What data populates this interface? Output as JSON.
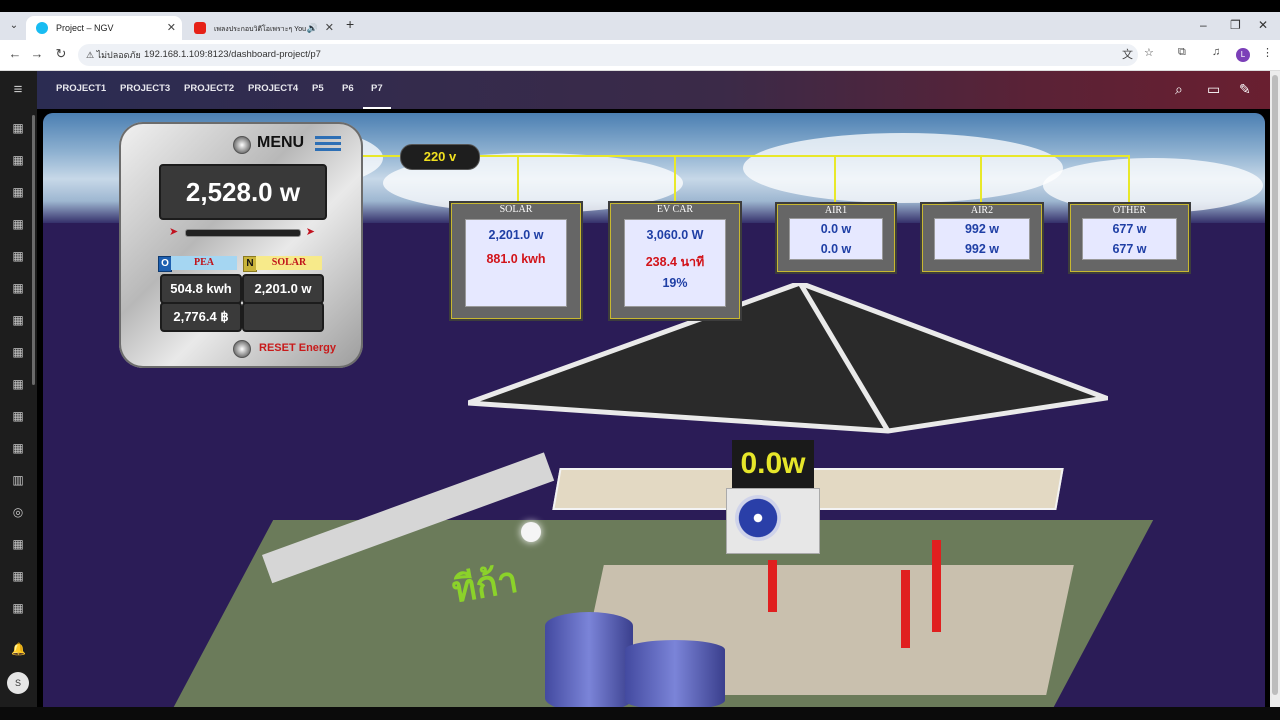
{
  "browser": {
    "tabs": [
      {
        "title": "Project – NGV",
        "active": true
      },
      {
        "title": "เพลงประกอบวิดีโอเพราะๆ You",
        "active": false,
        "audio": true
      }
    ],
    "new_tab": "+",
    "window_controls": {
      "minimize": "–",
      "restore": "❐",
      "close": "✕"
    },
    "address": {
      "security_label": "ไม่ปลอดภัย",
      "url": "192.168.1.109:8123/dashboard-project/p7"
    },
    "nav": {
      "back": "←",
      "forward": "→",
      "reload": "↻"
    },
    "profile_initial": "L"
  },
  "ha": {
    "tabs": [
      "PROJECT1",
      "PROJECT3",
      "PROJECT2",
      "PROJECT4",
      "P5",
      "P6",
      "P7"
    ],
    "active_tab": "P7",
    "user_initial": "S"
  },
  "menu_panel": {
    "title": "MENU",
    "total_power": "2,528.0 w",
    "pea_tag": "O",
    "pea_label": "PEA",
    "solar_tag": "N",
    "solar_label": "SOLAR",
    "pea_energy": "504.8 kwh",
    "solar_power": "2,201.0 w",
    "cost": "2,776.4 ฿",
    "empty_value": "",
    "reset_label": "RESET Energy"
  },
  "bus": {
    "voltage": "220 v"
  },
  "meters": {
    "solar": {
      "title": "SOLAR",
      "power": "2,201.0 w",
      "energy": "881.0 kwh"
    },
    "ev_car": {
      "title": "EV CAR",
      "power": "3,060.0 W",
      "time": "238.4 นาที",
      "percent": "19%"
    },
    "air1": {
      "title": "AIR1",
      "value1": "0.0 w",
      "value2": "0.0 w"
    },
    "air2": {
      "title": "AIR2",
      "value1": "992 w",
      "value2": "992 w"
    },
    "other": {
      "title": "OTHER",
      "value1": "677 w",
      "value2": "677 w"
    }
  },
  "scene": {
    "ac_display": "0.0w",
    "sign_text": "ทีก้า"
  },
  "colors": {
    "header_start": "#2b2c52",
    "header_end": "#6a1f30",
    "bus_yellow": "#e8e82a",
    "value_blue": "#1f3fa5",
    "value_red": "#d2141a"
  }
}
